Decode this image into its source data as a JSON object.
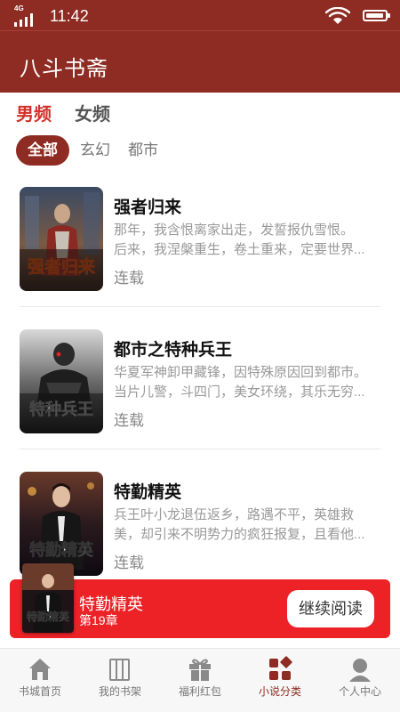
{
  "status_bar": {
    "network": "4G",
    "time": "11:42"
  },
  "app_bar": {
    "title": "八斗书斋"
  },
  "gender_tabs": [
    {
      "label": "男频",
      "active": true
    },
    {
      "label": "女频",
      "active": false
    }
  ],
  "categories": [
    {
      "label": "全部",
      "active": true
    },
    {
      "label": "玄幻",
      "active": false
    },
    {
      "label": "都市",
      "active": false
    }
  ],
  "books": [
    {
      "title": "强者归来",
      "desc_line1": "那年，我含恨离家出走，发誓报仇雪恨。",
      "desc_line2": "后来，我涅槃重生，卷土重来，定要世界...",
      "status": "连载",
      "cover_text": "强者归来"
    },
    {
      "title": "都市之特种兵王",
      "desc_line1": "华夏军神卸甲藏锋，因特殊原因回到都市。",
      "desc_line2": "当片儿警，斗四门，美女环绕，其乐无穷...",
      "status": "连载",
      "cover_text": "特种兵王"
    },
    {
      "title": "特勤精英",
      "desc_line1": "兵王叶小龙退伍返乡，路遇不平，英雄救",
      "desc_line2": "美，却引来不明势力的疯狂报复，且看他...",
      "status": "连载",
      "cover_text": "特勤精英"
    }
  ],
  "continue_reading": {
    "title": "特勤精英",
    "chapter": "第19章",
    "button": "继续阅读"
  },
  "tab_bar": [
    {
      "label": "书城首页",
      "icon": "home-icon",
      "active": false
    },
    {
      "label": "我的书架",
      "icon": "bookshelf-icon",
      "active": false
    },
    {
      "label": "福利红包",
      "icon": "gift-icon",
      "active": false
    },
    {
      "label": "小说分类",
      "icon": "category-icon",
      "active": true
    },
    {
      "label": "个人中心",
      "icon": "user-icon",
      "active": false
    }
  ],
  "colors": {
    "primary": "#8e2b22",
    "accent": "#d3312a",
    "banner": "#ec2227"
  }
}
